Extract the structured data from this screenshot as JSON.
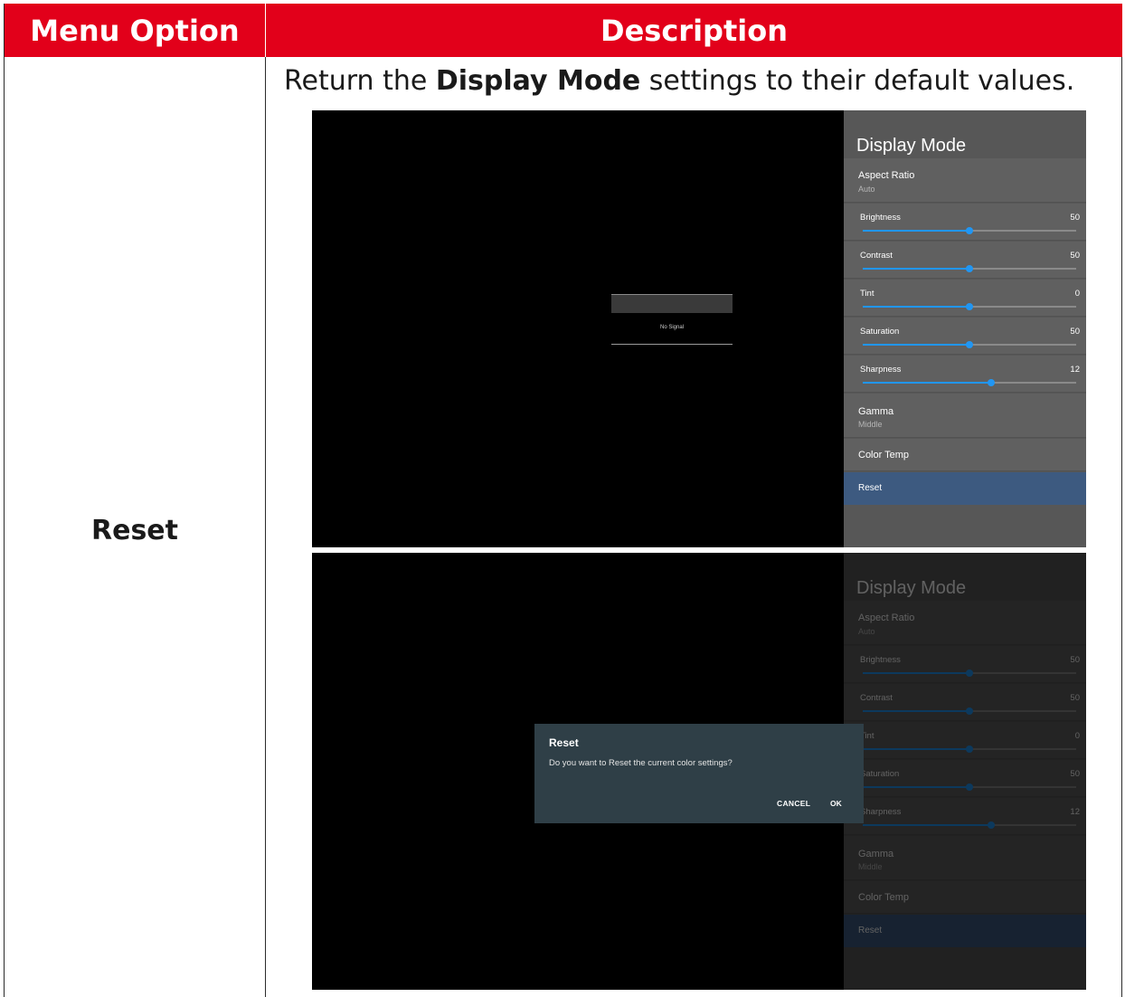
{
  "table": {
    "header": {
      "menu_option": "Menu Option",
      "description": "Description"
    },
    "row": {
      "menu_option": "Reset",
      "description_prefix": "Return the ",
      "description_bold": "Display Mode",
      "description_suffix": " settings to their default values."
    }
  },
  "osd": {
    "title": "Display Mode",
    "no_signal": "No Signal",
    "aspect_ratio": {
      "label": "Aspect Ratio",
      "value": "Auto"
    },
    "sliders": [
      {
        "label": "Brightness",
        "value": "50",
        "level": 0.5
      },
      {
        "label": "Contrast",
        "value": "50",
        "level": 0.5
      },
      {
        "label": "Tint",
        "value": "0",
        "level": 0.5
      },
      {
        "label": "Saturation",
        "value": "50",
        "level": 0.5
      },
      {
        "label": "Sharpness",
        "value": "12",
        "level": 0.6
      }
    ],
    "gamma": {
      "label": "Gamma",
      "value": "Middle"
    },
    "color_temp": {
      "label": "Color Temp"
    },
    "reset": {
      "label": "Reset"
    },
    "accent_color": "#2196f3",
    "selected_color": "#3d5a80"
  },
  "dialog": {
    "title": "Reset",
    "message": "Do you want to Reset the current color settings?",
    "cancel_label": "CANCEL",
    "ok_label": "OK"
  },
  "icons": {}
}
